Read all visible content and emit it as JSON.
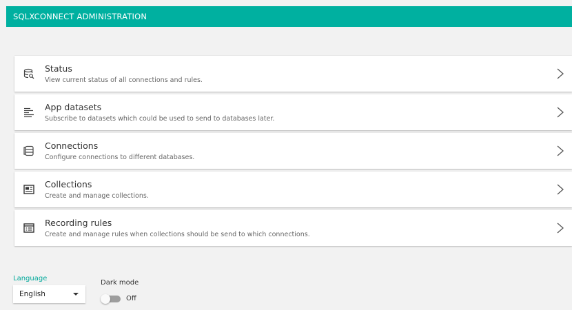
{
  "app": {
    "title": "SQLXCONNECT ADMINISTRATION"
  },
  "menu": [
    {
      "title": "Status",
      "description": "View current status of all connections and rules.",
      "icon": "database-search-icon"
    },
    {
      "title": "App datasets",
      "description": "Subscribe to datasets which could be used to send to databases later.",
      "icon": "dataset-list-icon"
    },
    {
      "title": "Connections",
      "description": "Configure connections to different databases.",
      "icon": "database-connection-icon"
    },
    {
      "title": "Collections",
      "description": "Create and manage collections.",
      "icon": "collection-card-icon"
    },
    {
      "title": "Recording rules",
      "description": "Create and manage rules when collections should be send to which connections.",
      "icon": "rules-list-icon"
    }
  ],
  "settings": {
    "language": {
      "label": "Language",
      "selected": "English"
    },
    "dark_mode": {
      "label": "Dark mode",
      "state_text": "Off",
      "enabled": false
    }
  },
  "colors": {
    "header": "#00b0a0",
    "accent": "#00a89a"
  }
}
